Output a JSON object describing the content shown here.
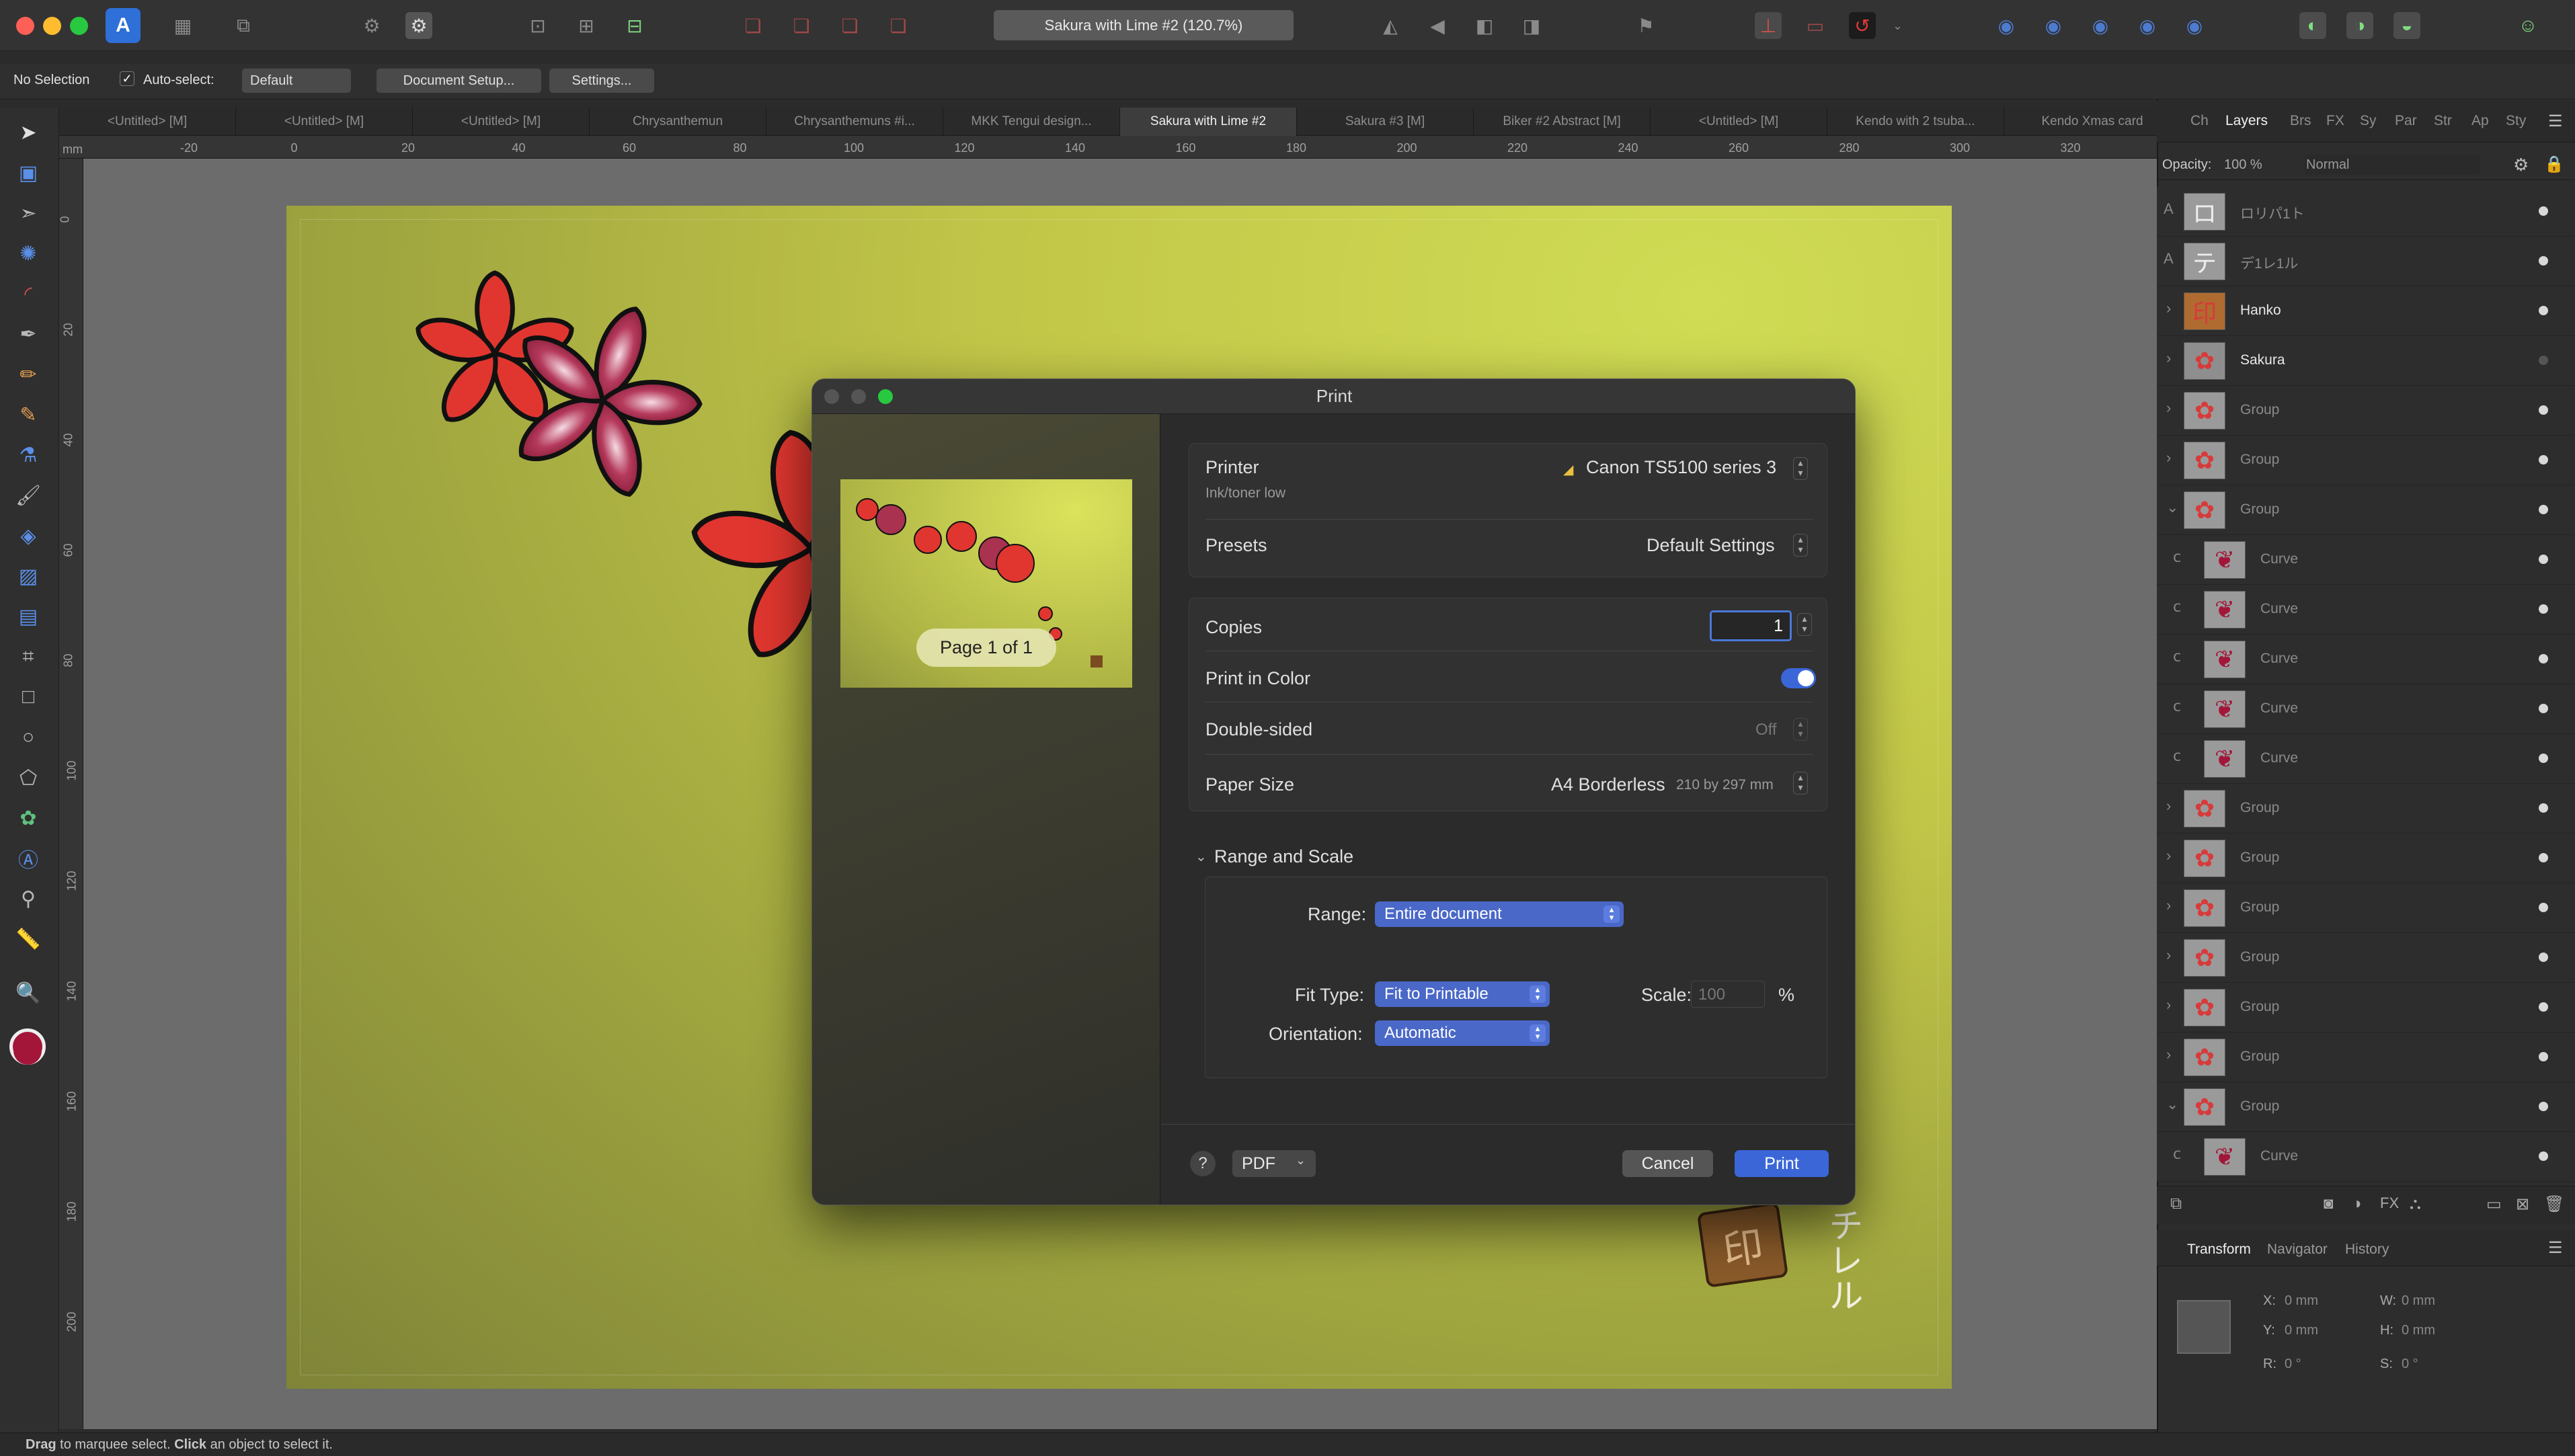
{
  "app": {
    "document_title": "Sakura with Lime #2 (120.7%)"
  },
  "context_bar": {
    "selection": "No Selection",
    "auto_select_label": "Auto-select:",
    "auto_select_value": "Default",
    "document_setup": "Document Setup...",
    "settings": "Settings..."
  },
  "tabs": [
    {
      "label": "<Untitled> [M]"
    },
    {
      "label": "<Untitled> [M]"
    },
    {
      "label": "<Untitled> [M]"
    },
    {
      "label": "Chrysanthemun"
    },
    {
      "label": "Chrysanthemuns #i..."
    },
    {
      "label": "MKK Tengui design..."
    },
    {
      "label": "Sakura with Lime #2"
    },
    {
      "label": "Sakura #3 [M]"
    },
    {
      "label": "Biker #2 Abstract [M]"
    },
    {
      "label": "<Untitled> [M]"
    },
    {
      "label": "Kendo with 2 tsuba..."
    },
    {
      "label": "Kendo Xmas card"
    }
  ],
  "ruler": {
    "unit": "mm",
    "h_ticks": [
      "-20",
      "0",
      "20",
      "40",
      "60",
      "80",
      "100",
      "120",
      "140",
      "160",
      "180",
      "200",
      "220",
      "240",
      "260",
      "280",
      "300",
      "320"
    ],
    "v_ticks": [
      "0",
      "20",
      "40",
      "60",
      "80",
      "100",
      "120",
      "140",
      "160",
      "180",
      "200"
    ]
  },
  "print_dialog": {
    "title": "Print",
    "page_indicator": "Page 1 of 1",
    "printer_label": "Printer",
    "printer_value": "Canon TS5100 series 3",
    "printer_status": "Ink/toner low",
    "presets_label": "Presets",
    "presets_value": "Default Settings",
    "copies_label": "Copies",
    "copies_value": "1",
    "color_label": "Print in Color",
    "color_on": true,
    "duplex_label": "Double-sided",
    "duplex_value": "Off",
    "paper_label": "Paper Size",
    "paper_value": "A4 Borderless",
    "paper_dims": "210 by 297 mm",
    "range_scale_header": "Range and Scale",
    "range_label": "Range:",
    "range_value": "Entire document",
    "fit_label": "Fit Type:",
    "fit_value": "Fit to Printable",
    "scale_label": "Scale:",
    "scale_value": "100",
    "scale_unit": "%",
    "orientation_label": "Orientation:",
    "orientation_value": "Automatic",
    "help": "?",
    "pdf_label": "PDF",
    "cancel": "Cancel",
    "print": "Print"
  },
  "right_panel": {
    "tabs": [
      "Ch",
      "Layers",
      "Brs",
      "FX",
      "Sy",
      "Par",
      "Str",
      "Ap",
      "Sty"
    ],
    "active_tab": "Layers",
    "opacity_label": "Opacity:",
    "opacity_value": "100 %",
    "blend_mode": "Normal",
    "layers": [
      {
        "name": "ロリパ1ト",
        "kind": "text",
        "dim": true,
        "chev": "",
        "thumb": "ロ",
        "bg": "#9a9a9a"
      },
      {
        "name": "デ1レ1ル",
        "kind": "text",
        "dim": true,
        "chev": "",
        "thumb": "テ",
        "bg": "#9a9a9a"
      },
      {
        "name": "Hanko",
        "kind": "image",
        "dim": false,
        "chev": "›",
        "thumb": "印",
        "bg": "#b06b30"
      },
      {
        "name": "Sakura",
        "kind": "group",
        "dim": false,
        "chev": "›",
        "thumb": "✿",
        "bg": "#8e8e8e"
      },
      {
        "name": "Group",
        "kind": "group",
        "dim": true,
        "chev": "›",
        "thumb": "✿",
        "bg": "#9a9a9a"
      },
      {
        "name": "Group",
        "kind": "group",
        "dim": true,
        "chev": "›",
        "thumb": "✿",
        "bg": "#9a9a9a"
      },
      {
        "name": "Group",
        "kind": "group",
        "dim": true,
        "chev": "⌄",
        "thumb": "✿",
        "bg": "#9a9a9a"
      },
      {
        "name": "Curve",
        "kind": "curve",
        "dim": true,
        "chev": "",
        "thumb": "❦",
        "bg": "#9a9a9a"
      },
      {
        "name": "Curve",
        "kind": "curve",
        "dim": true,
        "chev": "",
        "thumb": "❦",
        "bg": "#9a9a9a"
      },
      {
        "name": "Curve",
        "kind": "curve",
        "dim": true,
        "chev": "",
        "thumb": "❦",
        "bg": "#9a9a9a"
      },
      {
        "name": "Curve",
        "kind": "curve",
        "dim": true,
        "chev": "",
        "thumb": "❦",
        "bg": "#9a9a9a"
      },
      {
        "name": "Curve",
        "kind": "curve",
        "dim": true,
        "chev": "",
        "thumb": "❦",
        "bg": "#9a9a9a"
      },
      {
        "name": "Group",
        "kind": "group",
        "dim": true,
        "chev": "›",
        "thumb": "✿",
        "bg": "#9a9a9a"
      },
      {
        "name": "Group",
        "kind": "group",
        "dim": true,
        "chev": "›",
        "thumb": "✿",
        "bg": "#9a9a9a"
      },
      {
        "name": "Group",
        "kind": "group",
        "dim": true,
        "chev": "›",
        "thumb": "✿",
        "bg": "#9a9a9a"
      },
      {
        "name": "Group",
        "kind": "group",
        "dim": true,
        "chev": "›",
        "thumb": "✿",
        "bg": "#9a9a9a"
      },
      {
        "name": "Group",
        "kind": "group",
        "dim": true,
        "chev": "›",
        "thumb": "✿",
        "bg": "#9a9a9a"
      },
      {
        "name": "Group",
        "kind": "group",
        "dim": true,
        "chev": "›",
        "thumb": "✿",
        "bg": "#9a9a9a"
      },
      {
        "name": "Group",
        "kind": "group",
        "dim": true,
        "chev": "⌄",
        "thumb": "✿",
        "bg": "#9a9a9a"
      },
      {
        "name": "Curve",
        "kind": "curve",
        "dim": true,
        "chev": "",
        "thumb": "❦",
        "bg": "#9a9a9a"
      }
    ],
    "bottom_tabs": [
      "Transform",
      "Navigator",
      "History"
    ],
    "transform": {
      "x_label": "X:",
      "x": "0 mm",
      "y_label": "Y:",
      "y": "0 mm",
      "w_label": "W:",
      "w": "0 mm",
      "h_label": "H:",
      "h": "0 mm",
      "r_label": "R:",
      "r": "0 °",
      "s_label": "S:",
      "s": "0 °"
    }
  },
  "artwork": {
    "kana_text": "チレル"
  },
  "status": {
    "drag": "Drag",
    "drag_rest": " to marquee select. ",
    "click": "Click",
    "click_rest": " an object to select it."
  },
  "colors": {
    "accent_blue": "#4a68c8",
    "print_blue": "#3a66d8",
    "close_red": "#fe5f57",
    "min_yellow": "#febc2e",
    "max_green": "#28c840",
    "sakura_red": "#e0362f",
    "sakura_crimson": "#9c1f3c",
    "lime": "#c8d24c",
    "fill_swatch": "#a3163a"
  }
}
